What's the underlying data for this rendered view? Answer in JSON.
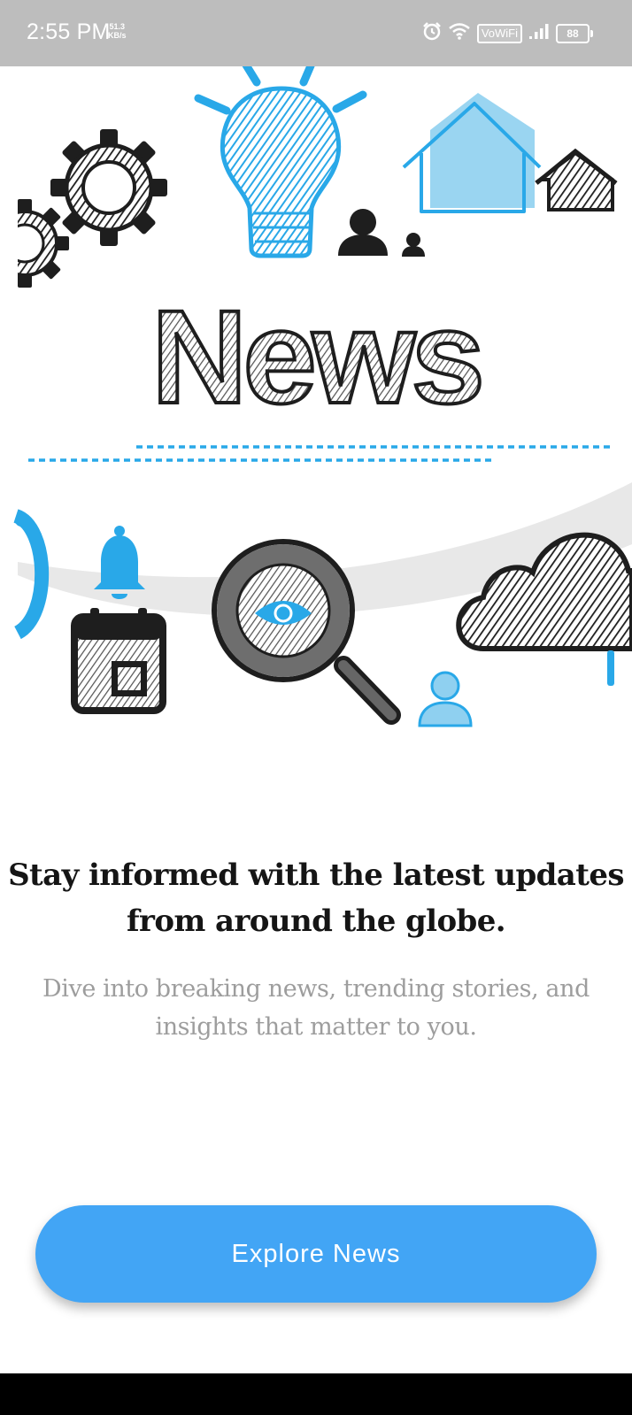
{
  "status_bar": {
    "time": "2:55 PM",
    "net_speed_value": "51.3",
    "net_speed_unit": "KB/s",
    "network_label": "VoWiFi",
    "battery_level": "88"
  },
  "hero": {
    "title": "News"
  },
  "content": {
    "headline": "Stay informed with the latest updates from around the globe.",
    "subtitle": "Dive into breaking news, trending stories, and insights that matter to you."
  },
  "cta": {
    "label": "Explore News"
  },
  "colors": {
    "accent": "#42a5f5",
    "illustration_blue": "#29a8e8",
    "illustration_dark": "#1e1e1e",
    "status_bar_bg": "#bdbdbd"
  }
}
